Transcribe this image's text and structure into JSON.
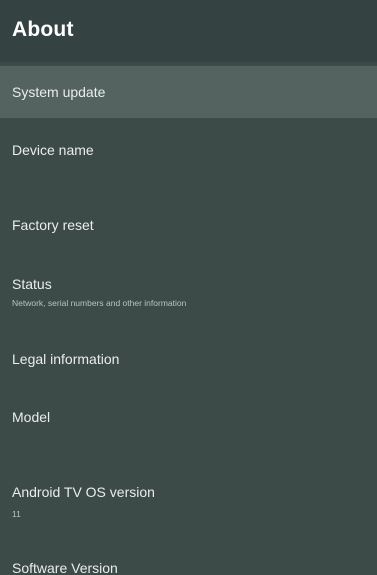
{
  "header": {
    "title": "About"
  },
  "items": [
    {
      "label": "System update"
    },
    {
      "label": "Device name"
    },
    {
      "label": "Factory reset"
    },
    {
      "label": "Status",
      "sub": "Network, serial numbers and other information"
    },
    {
      "label": "Legal information"
    },
    {
      "label": "Model"
    },
    {
      "label": "Android TV OS version",
      "sub": "11"
    },
    {
      "label": "Software Version"
    }
  ],
  "colors": {
    "panel_bg": "#3c4a48",
    "header_bg": "#344341",
    "focused_bg": "#546260",
    "text_primary": "#e9edeb",
    "text_secondary": "#b9c3c0"
  }
}
